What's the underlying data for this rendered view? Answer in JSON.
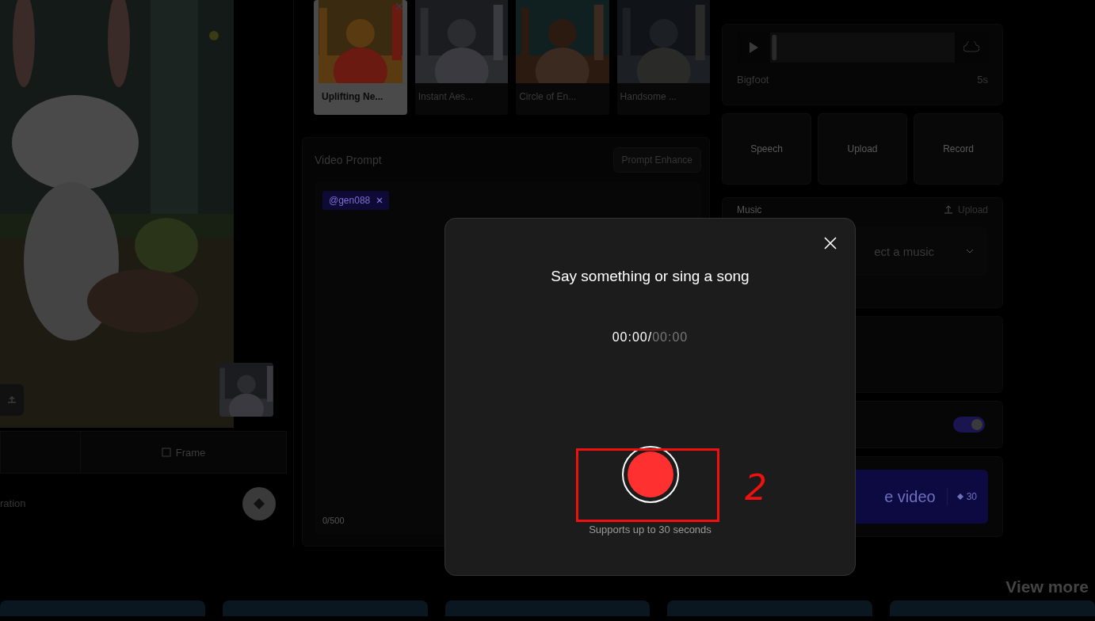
{
  "left_panel": {
    "frame_tab": "Frame",
    "footer_label": "ration"
  },
  "templates": [
    {
      "title": "Uplifting Ne...",
      "selected": true
    },
    {
      "title": "Instant Aes...",
      "selected": false
    },
    {
      "title": "Circle of En...",
      "selected": false
    },
    {
      "title": "Handsome ...",
      "selected": false
    }
  ],
  "video_prompt": {
    "title": "Video Prompt",
    "enhance_button": "Prompt Enhance",
    "tag": "@gen088",
    "counter": "0/500"
  },
  "voice": {
    "name": "Bigfoot",
    "duration": "5s",
    "buttons": [
      "Speech",
      "Upload",
      "Record"
    ]
  },
  "music": {
    "title": "Music",
    "upload": "Upload",
    "select_value": "ect a music"
  },
  "toggle": {
    "on": true
  },
  "generate": {
    "label": "e video",
    "cost": "30"
  },
  "view_more": "View more",
  "dialog": {
    "title": "Say something or sing a song",
    "elapsed": "00:00",
    "separator": "/",
    "total": "00:00",
    "note": "Supports up to 30 seconds"
  },
  "annotation": {
    "label": "2"
  }
}
